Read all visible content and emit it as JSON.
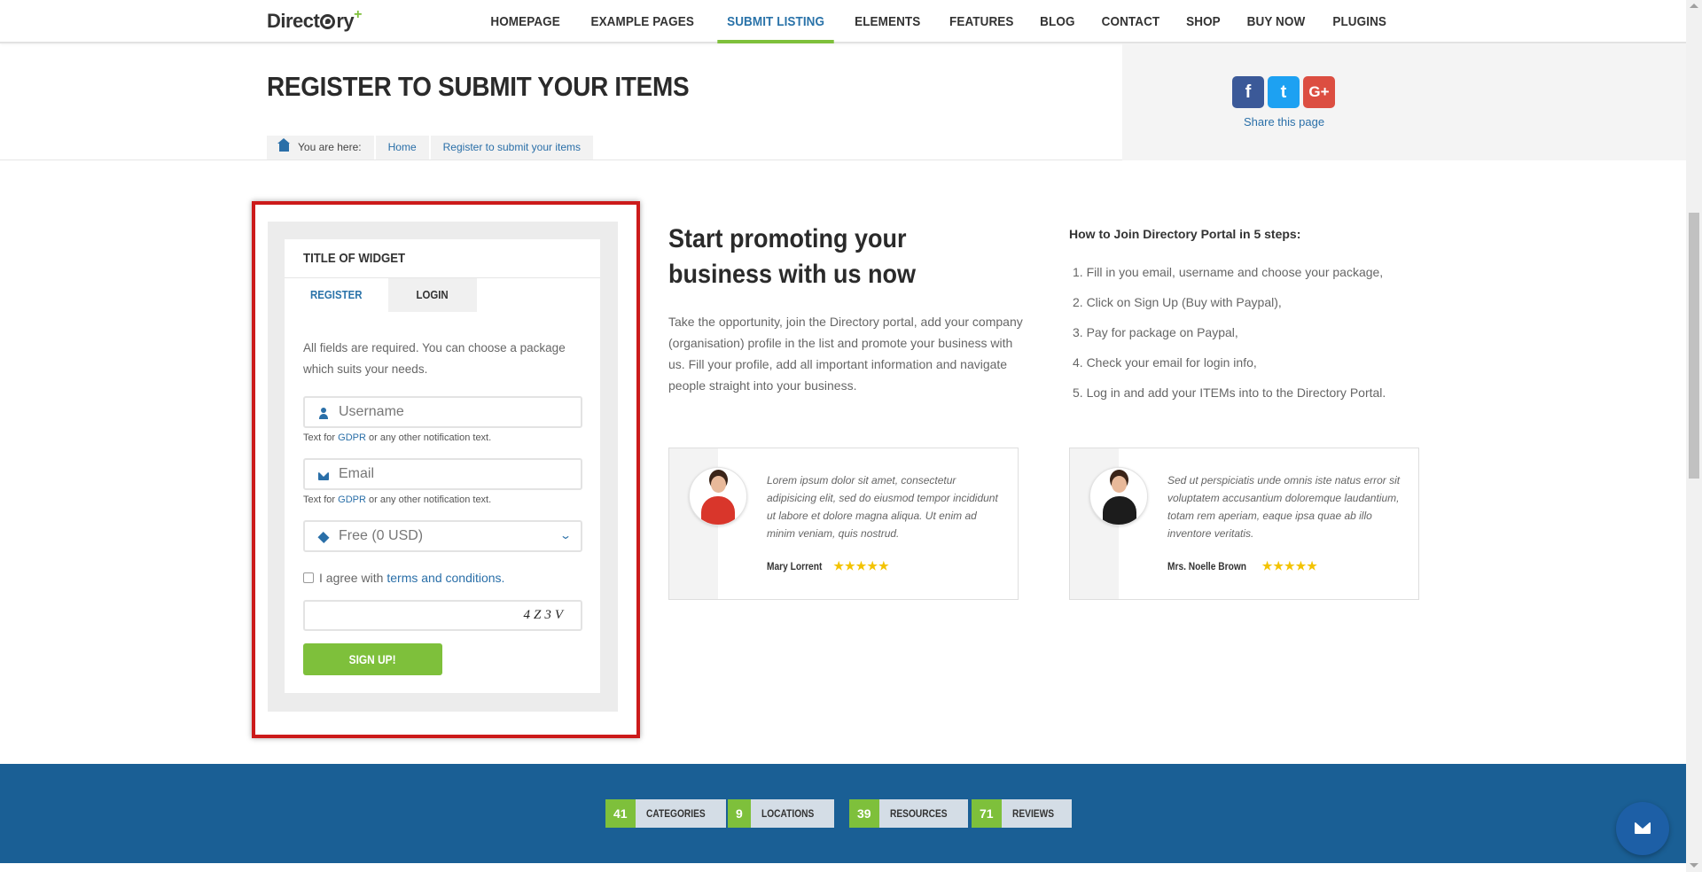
{
  "header": {
    "logo_text": "Direct",
    "logo_tail": "ry",
    "logo_plus": "+",
    "nav": [
      "HOMEPAGE",
      "EXAMPLE PAGES",
      "SUBMIT LISTING",
      "ELEMENTS",
      "FEATURES",
      "BLOG",
      "CONTACT",
      "SHOP",
      "BUY NOW",
      "PLUGINS"
    ],
    "active_nav": "SUBMIT LISTING"
  },
  "page": {
    "title": "REGISTER TO SUBMIT YOUR ITEMS",
    "breadcrumb": {
      "prefix": "You are here:",
      "items": [
        "Home",
        "Register to submit your items"
      ]
    },
    "share": {
      "text": "Share this page",
      "icons": [
        {
          "name": "facebook-icon",
          "glyph": "f",
          "color": "#3b5998"
        },
        {
          "name": "twitter-icon",
          "glyph": "t",
          "color": "#1da1f2"
        },
        {
          "name": "google-plus-icon",
          "glyph": "G+",
          "color": "#dc4e41"
        }
      ]
    }
  },
  "widget": {
    "title": "TITLE OF WIDGET",
    "tabs": [
      "REGISTER",
      "LOGIN"
    ],
    "active_tab": "REGISTER",
    "intro": "All fields are required. You can choose a package which suits your needs.",
    "username_placeholder": "Username",
    "email_placeholder": "Email",
    "notice_prefix": "Text for",
    "notice_link": "GDPR",
    "notice_suffix": "or any other notification text.",
    "package_value": "Free (0 USD)",
    "agree_prefix": "I agree with",
    "agree_link": "terms and conditions.",
    "captcha_code": "4Z3V",
    "signup_label": "SIGN UP!"
  },
  "promo": {
    "title": "Start promoting your business with us now",
    "text": "Take the opportunity, join the Directory portal, add your company (organisation) profile in the list and promote your business with us. Fill your profile, add all important information and navigate people straight into your business.",
    "steps_title": "How to Join Directory Portal in 5 steps:",
    "steps": [
      "1. Fill in you email, username and choose your package,",
      "2. Click on Sign Up (Buy with Paypal),",
      "3. Pay for package on Paypal,",
      "4. Check your email for login info,",
      "5. Log in and add your ITEMs into to the Directory Portal."
    ]
  },
  "testimonials": [
    {
      "quote": "Lorem ipsum dolor sit amet, consectetur adipisicing elit, sed do eiusmod tempor incididunt ut labore et dolore magna aliqua. Ut enim ad minim veniam, quis nostrud.",
      "author": "Mary Lorrent",
      "stars": "★★★★★"
    },
    {
      "quote": "Sed ut perspiciatis unde omnis iste natus error sit voluptatem accusantium doloremque laudantium, totam rem aperiam, eaque ipsa quae ab illo inventore veritatis.",
      "author": "Mrs. Noelle Brown",
      "stars": "★★★★★"
    }
  ],
  "stats": [
    {
      "num": "41",
      "label": "CATEGORIES"
    },
    {
      "num": "9",
      "label": "LOCATIONS"
    },
    {
      "num": "39",
      "label": "RESOURCES"
    },
    {
      "num": "71",
      "label": "REVIEWS"
    }
  ],
  "colors": {
    "accent_green": "#7ec03b",
    "link_blue": "#2a6fa8",
    "band_blue": "#1a5f95",
    "highlight_red": "#cc1a1a"
  }
}
